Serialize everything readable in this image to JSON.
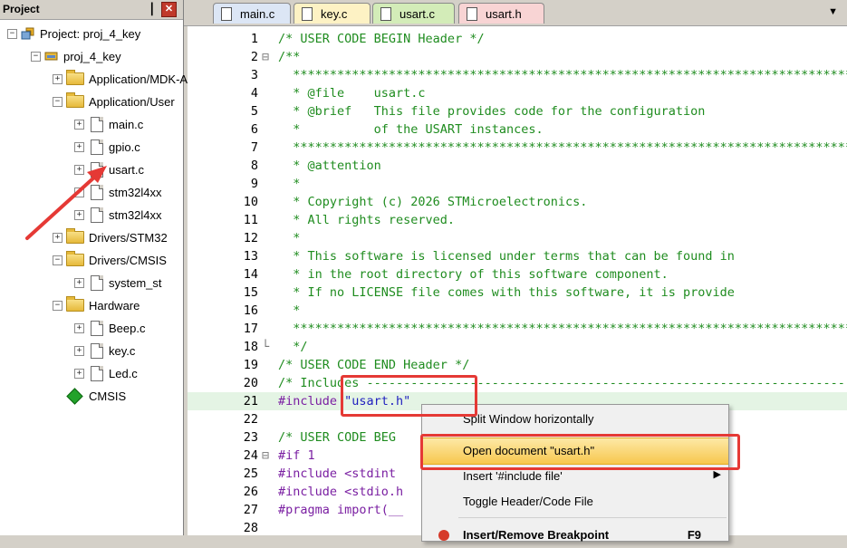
{
  "project_panel": {
    "title": "Project",
    "pin_glyph": "▕",
    "close_glyph": "✕",
    "tree": [
      {
        "label": "Project: proj_4_key",
        "expander": "−",
        "icon": "project-icon"
      },
      {
        "label": "proj_4_key",
        "expander": "−",
        "icon": "target-icon"
      },
      {
        "label": "Application/MDK-ARM",
        "expander": "+",
        "icon": "folder-icon"
      },
      {
        "label": "Application/User",
        "expander": "−",
        "icon": "folder-icon"
      },
      {
        "label": "main.c",
        "expander": "+",
        "icon": "file-icon"
      },
      {
        "label": "gpio.c",
        "expander": "+",
        "icon": "file-icon"
      },
      {
        "label": "usart.c",
        "expander": "+",
        "icon": "file-icon"
      },
      {
        "label": "stm32l4xx",
        "expander": "+",
        "icon": "file-icon"
      },
      {
        "label": "stm32l4xx",
        "expander": "+",
        "icon": "file-icon"
      },
      {
        "label": "Drivers/STM32",
        "expander": "+",
        "icon": "folder-icon"
      },
      {
        "label": "Drivers/CMSIS",
        "expander": "−",
        "icon": "folder-icon"
      },
      {
        "label": "system_st",
        "expander": "+",
        "icon": "file-icon"
      },
      {
        "label": "Hardware",
        "expander": "−",
        "icon": "folder-icon"
      },
      {
        "label": "Beep.c",
        "expander": "+",
        "icon": "file-icon"
      },
      {
        "label": "key.c",
        "expander": "+",
        "icon": "file-icon"
      },
      {
        "label": "Led.c",
        "expander": "+",
        "icon": "file-icon"
      },
      {
        "label": "CMSIS",
        "expander": "",
        "icon": "cmsis-icon"
      }
    ]
  },
  "tabs": [
    {
      "label": "main.c",
      "color": "#dce6f5"
    },
    {
      "label": "key.c",
      "color": "#fdf2c4"
    },
    {
      "label": "usart.c",
      "color": "#d3ecb8"
    },
    {
      "label": "usart.h",
      "color": "#f8d4d4"
    }
  ],
  "tab_dropdown_glyph": "▼",
  "editor": {
    "lines": [
      {
        "n": "1",
        "fold": "",
        "text": "/* USER CODE BEGIN Header */",
        "kind": "comment"
      },
      {
        "n": "2",
        "fold": "⊟",
        "text": "/**",
        "kind": "comment"
      },
      {
        "n": "3",
        "fold": "",
        "text": "  ******************************************************************************",
        "kind": "comment"
      },
      {
        "n": "4",
        "fold": "",
        "text": "  * @file    usart.c",
        "kind": "comment"
      },
      {
        "n": "5",
        "fold": "",
        "text": "  * @brief   This file provides code for the configuration",
        "kind": "comment"
      },
      {
        "n": "6",
        "fold": "",
        "text": "  *          of the USART instances.",
        "kind": "comment"
      },
      {
        "n": "7",
        "fold": "",
        "text": "  ******************************************************************************",
        "kind": "comment"
      },
      {
        "n": "8",
        "fold": "",
        "text": "  * @attention",
        "kind": "comment"
      },
      {
        "n": "9",
        "fold": "",
        "text": "  *",
        "kind": "comment"
      },
      {
        "n": "10",
        "fold": "",
        "text": "  * Copyright (c) 2026 STMicroelectronics.",
        "kind": "comment"
      },
      {
        "n": "11",
        "fold": "",
        "text": "  * All rights reserved.",
        "kind": "comment"
      },
      {
        "n": "12",
        "fold": "",
        "text": "  *",
        "kind": "comment"
      },
      {
        "n": "13",
        "fold": "",
        "text": "  * This software is licensed under terms that can be found in",
        "kind": "comment"
      },
      {
        "n": "14",
        "fold": "",
        "text": "  * in the root directory of this software component.",
        "kind": "comment"
      },
      {
        "n": "15",
        "fold": "",
        "text": "  * If no LICENSE file comes with this software, it is provide",
        "kind": "comment"
      },
      {
        "n": "16",
        "fold": "",
        "text": "  *",
        "kind": "comment"
      },
      {
        "n": "17",
        "fold": "",
        "text": "  ******************************************************************************",
        "kind": "comment"
      },
      {
        "n": "18",
        "fold": "└",
        "text": "  */",
        "kind": "comment"
      },
      {
        "n": "19",
        "fold": "",
        "text": "/* USER CODE END Header */",
        "kind": "comment"
      },
      {
        "n": "20",
        "fold": "",
        "text": "/* Includes ------------------------------------------------------------------",
        "kind": "comment"
      },
      {
        "n": "21",
        "fold": "",
        "text": "#include \"usart.h\"",
        "kind": "include"
      },
      {
        "n": "22",
        "fold": "",
        "text": "",
        "kind": "plain"
      },
      {
        "n": "23",
        "fold": "",
        "text": "/* USER CODE BEG",
        "kind": "comment"
      },
      {
        "n": "24",
        "fold": "⊟",
        "text": "#if 1",
        "kind": "prep"
      },
      {
        "n": "25",
        "fold": "",
        "text": "#include <stdint",
        "kind": "prep"
      },
      {
        "n": "26",
        "fold": "",
        "text": "#include <stdio.h",
        "kind": "prep"
      },
      {
        "n": "27",
        "fold": "",
        "text": "#pragma import(__",
        "kind": "prep"
      },
      {
        "n": "28",
        "fold": "",
        "text": "",
        "kind": "plain"
      }
    ]
  },
  "context_menu": {
    "items": [
      {
        "label": "Split Window horizontally"
      },
      {
        "label": "Open document \"usart.h\""
      },
      {
        "label": "Insert '#include file'"
      },
      {
        "label": "Toggle Header/Code File"
      },
      {
        "label": "Insert/Remove Breakpoint"
      }
    ],
    "submenu_glyph": "▶",
    "shortcut": "F9"
  },
  "colors": {
    "annotation_red": "#e53935",
    "comment_green": "#1f8c1f",
    "preprocessor_purple": "#7a1fa2"
  }
}
